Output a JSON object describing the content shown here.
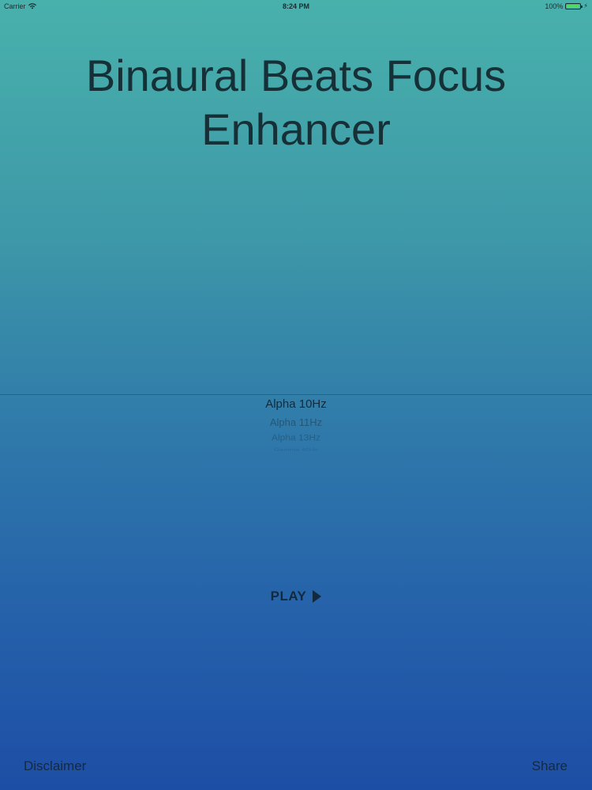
{
  "status_bar": {
    "carrier": "Carrier",
    "time": "8:24 PM",
    "battery": "100%",
    "battery_level": 1.0,
    "battery_color": "#4cd964",
    "icons": [
      "wifi-icon",
      "battery-icon",
      "charge-icon"
    ]
  },
  "title": {
    "line1": "Binaural Beats Focus",
    "line2": "Enhancer"
  },
  "picker": {
    "options": [
      "Alpha 10Hz",
      "Alpha 11Hz",
      "Alpha 13Hz",
      "Gamma 40Hz"
    ],
    "selected": "Alpha 10Hz"
  },
  "play": {
    "label": "PLAY",
    "icon": "play-icon"
  },
  "footer": {
    "disclaimer": "Disclaimer",
    "share": "Share"
  },
  "colors": {
    "gradient_top": "#49b1ac",
    "gradient_bottom": "#1d4ea6",
    "text": "#163037"
  }
}
